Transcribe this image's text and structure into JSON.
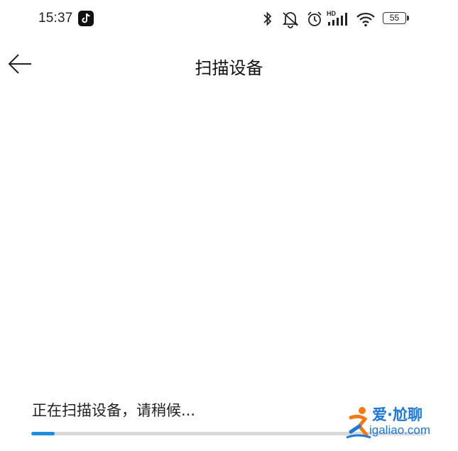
{
  "status_bar": {
    "time": "15:37",
    "battery_level": "55",
    "signal_label": "HD",
    "icons": [
      "tiktok-icon",
      "bluetooth-icon",
      "mute-icon",
      "alarm-icon",
      "signal-icon",
      "wifi-icon",
      "battery-icon"
    ]
  },
  "app_bar": {
    "title": "扫描设备",
    "back_icon": "arrow-left-icon"
  },
  "scan": {
    "status_text": "正在扫描设备，请稍候...",
    "progress_fraction": 0.06,
    "accent_color": "#1a8fe0"
  },
  "watermark": {
    "brand": "爱·尬聊",
    "url": "igaliao.com"
  }
}
